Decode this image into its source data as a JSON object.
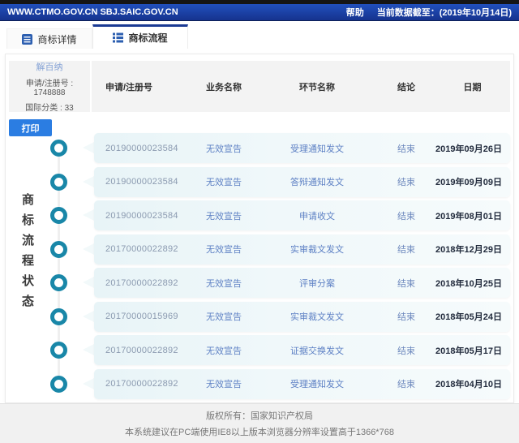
{
  "topbar": {
    "site_urls": "WWW.CTMO.GOV.CN SBJ.SAIC.GOV.CN",
    "help_label": "帮助",
    "data_as_of": "当前数据截至：(2019年10月14日)"
  },
  "tabs": [
    {
      "label": "商标详情",
      "active": false
    },
    {
      "label": "商标流程",
      "active": true
    }
  ],
  "trademark": {
    "name": "解百纳",
    "reg_no": "申请/注册号 : 1748888",
    "intl_class": "国际分类 : 33"
  },
  "print_button_label": "打印",
  "side_label": "商标流程状态",
  "table": {
    "headers": [
      "申请/注册号",
      "业务名称",
      "环节名称",
      "结论",
      "日期"
    ],
    "rows": [
      [
        "20190000023584",
        "无效宣告",
        "受理通知发文",
        "结束",
        "2019年09月26日"
      ],
      [
        "20190000023584",
        "无效宣告",
        "答辩通知发文",
        "结束",
        "2019年09月09日"
      ],
      [
        "20190000023584",
        "无效宣告",
        "申请收文",
        "结束",
        "2019年08月01日"
      ],
      [
        "20170000022892",
        "无效宣告",
        "实审裁文发文",
        "结束",
        "2018年12月29日"
      ],
      [
        "20170000022892",
        "无效宣告",
        "评审分案",
        "结束",
        "2018年10月25日"
      ],
      [
        "20170000015969",
        "无效宣告",
        "实审裁文发文",
        "结束",
        "2018年05月24日"
      ],
      [
        "20170000022892",
        "无效宣告",
        "证据交换发文",
        "结束",
        "2018年05月17日"
      ],
      [
        "20170000022892",
        "无效宣告",
        "受理通知发文",
        "结束",
        "2018年04月10日"
      ]
    ]
  },
  "footer": {
    "line1": "版权所有：国家知识产权局",
    "line2": "本系统建议在PC端使用IE8以上版本浏览器分辨率设置高于1366*768"
  },
  "colors": {
    "topbar_blue": "#1b3f9e",
    "tab_active_border": "#1a3a94",
    "timeline_teal": "#1987a8",
    "print_blue": "#2b7de2",
    "row_text_blue": "#5d80c4",
    "row_bg": "#e8f4f7",
    "footer_bg": "#f1f1f1"
  }
}
